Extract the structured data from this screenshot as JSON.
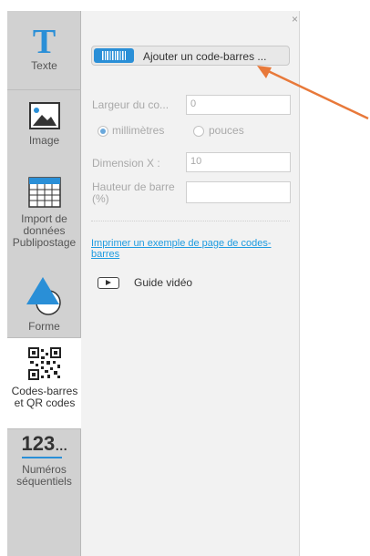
{
  "sidebar": {
    "items": [
      {
        "label": "Texte",
        "icon": "text-t-icon",
        "glyph": "T"
      },
      {
        "label": "Image",
        "icon": "image-icon"
      },
      {
        "label": "Import de\ndonnées\nPublipostage",
        "icon": "spreadsheet-icon"
      },
      {
        "label": "Forme",
        "icon": "shapes-icon"
      },
      {
        "label": "Codes-barres\net QR codes",
        "icon": "qr-code-icon",
        "active": true
      },
      {
        "label": "Numéros\nséquentiels",
        "icon": "sequential-number-icon",
        "glyph": "123"
      }
    ]
  },
  "panel": {
    "close_glyph": "×",
    "add_button_label": "Ajouter un code-barres ...",
    "width_label": "Largeur du co...",
    "width_value": "0",
    "unit_mm_label": "millimètres",
    "unit_in_label": "pouces",
    "selected_unit": "millimètres",
    "dimension_x_label": "Dimension X :",
    "dimension_x_value": "10",
    "bar_height_label": "Hauteur de barre (%)",
    "bar_height_value": "",
    "print_link": "Imprimer un exemple de page de codes-barres",
    "video_label": "Guide vidéo"
  },
  "colors": {
    "accent": "#2a8fd7",
    "link": "#1e9be0",
    "arrow": "#e8793a",
    "sidebar_bg": "#d1d1d1",
    "panel_bg": "#f2f2f2"
  }
}
